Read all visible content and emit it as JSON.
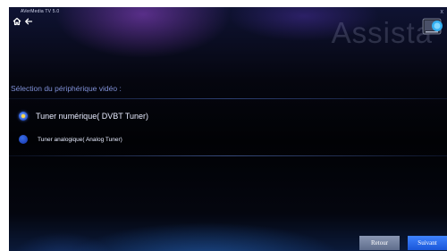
{
  "app": {
    "title": "AVerMedia TV 5.0",
    "watermark": "Assista",
    "window_control": "x"
  },
  "section": {
    "label": "Sélection du périphérique vidéo :"
  },
  "options": [
    {
      "label": "Tuner numérique( DVBT Tuner)",
      "selected": true
    },
    {
      "label": "Tuner analogique( Analog Tuner)",
      "selected": false
    }
  ],
  "buttons": {
    "back_label": "Retour",
    "next_label": "Suivant"
  },
  "icons": {
    "home": "home-icon",
    "back": "back-arrow-icon",
    "logo": "app-logo-icon"
  },
  "colors": {
    "accent": "#2a6bff",
    "selected_dot": "#ffd94a",
    "section_label": "#7f90d6"
  }
}
